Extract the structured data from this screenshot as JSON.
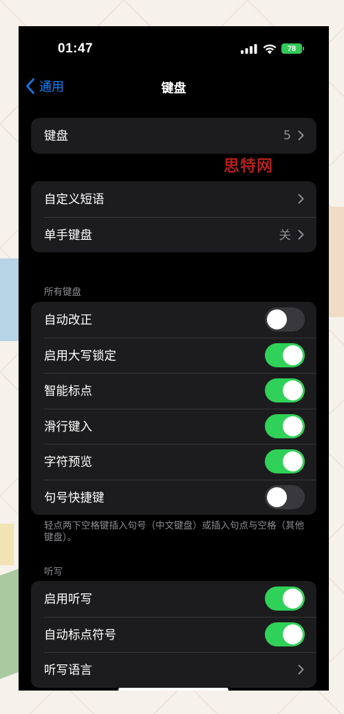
{
  "status_bar": {
    "time": "01:47",
    "battery": "78",
    "signal_icon": "cellular-signal-icon",
    "wifi_icon": "wifi-icon"
  },
  "nav": {
    "back_label": "通用",
    "title": "键盘"
  },
  "keyboards_group": {
    "label": "键盘",
    "value": "5"
  },
  "shortcuts_group": {
    "items": [
      {
        "label": "自定义短语",
        "value": ""
      },
      {
        "label": "单手键盘",
        "value": "关"
      }
    ]
  },
  "all_keyboards": {
    "header": "所有键盘",
    "toggles": [
      {
        "label": "自动改正",
        "on": false
      },
      {
        "label": "启用大写锁定",
        "on": true
      },
      {
        "label": "智能标点",
        "on": true
      },
      {
        "label": "滑行键入",
        "on": true
      },
      {
        "label": "字符预览",
        "on": true
      },
      {
        "label": "句号快捷键",
        "on": false
      }
    ],
    "footer": "轻点两下空格键插入句号（中文键盘）或插入句点与空格（其他键盘）。"
  },
  "dictation": {
    "header": "听写",
    "toggles": [
      {
        "label": "启用听写",
        "on": true
      },
      {
        "label": "自动标点符号",
        "on": true
      }
    ],
    "language_label": "听写语言"
  },
  "watermark": "思特网",
  "colors": {
    "accent": "#0a84ff",
    "toggle_on": "#30d158",
    "toggle_off": "#39393d",
    "cell_bg": "#1c1c1e",
    "battery": "#34c759",
    "watermark": "#b21f1f"
  }
}
